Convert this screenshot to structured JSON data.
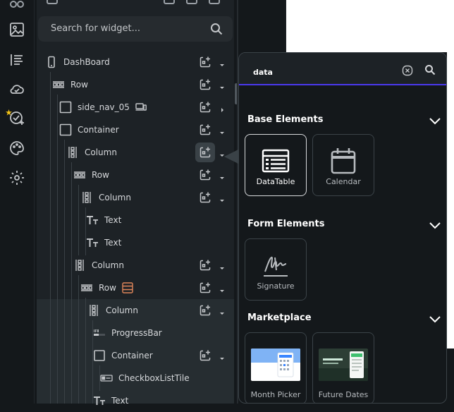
{
  "widget_search": {
    "placeholder": "Search for widget..."
  },
  "tree": [
    {
      "label": "DashBoard",
      "icon": "phone-icon"
    },
    {
      "label": "Row",
      "icon": "row-icon"
    },
    {
      "label": "side_nav_05",
      "icon": "container-icon",
      "extra_icon": "devices-icon"
    },
    {
      "label": "Container",
      "icon": "container-icon"
    },
    {
      "label": "Column",
      "icon": "column-icon"
    },
    {
      "label": "Row",
      "icon": "row-icon"
    },
    {
      "label": "Column",
      "icon": "column-icon"
    },
    {
      "label": "Text",
      "icon": "text-icon"
    },
    {
      "label": "Text",
      "icon": "text-icon"
    },
    {
      "label": "Column",
      "icon": "column-icon"
    },
    {
      "label": "Row",
      "icon": "row-icon",
      "extra_icon": "scroll-icon"
    },
    {
      "label": "Column",
      "icon": "column-icon"
    },
    {
      "label": "ProgressBar",
      "icon": "progressbar-icon"
    },
    {
      "label": "Container",
      "icon": "container-icon"
    },
    {
      "label": "CheckboxListTile",
      "icon": "checkbox-list-icon"
    },
    {
      "label": "Text",
      "icon": "text-icon"
    }
  ],
  "popup": {
    "query": "data",
    "sections": [
      {
        "title": "Base Elements",
        "items": [
          "DataTable",
          "Calendar"
        ]
      },
      {
        "title": "Form Elements",
        "items": [
          "Signature"
        ]
      },
      {
        "title": "Marketplace",
        "items": [
          "Month Picker",
          "Future Dates"
        ]
      }
    ]
  },
  "colors": {
    "accent": "#4b39ef",
    "extra_icon_orange": "#e0865a",
    "thumb_blue": "#3a86ff",
    "thumb_green": "#3fbf6f"
  }
}
